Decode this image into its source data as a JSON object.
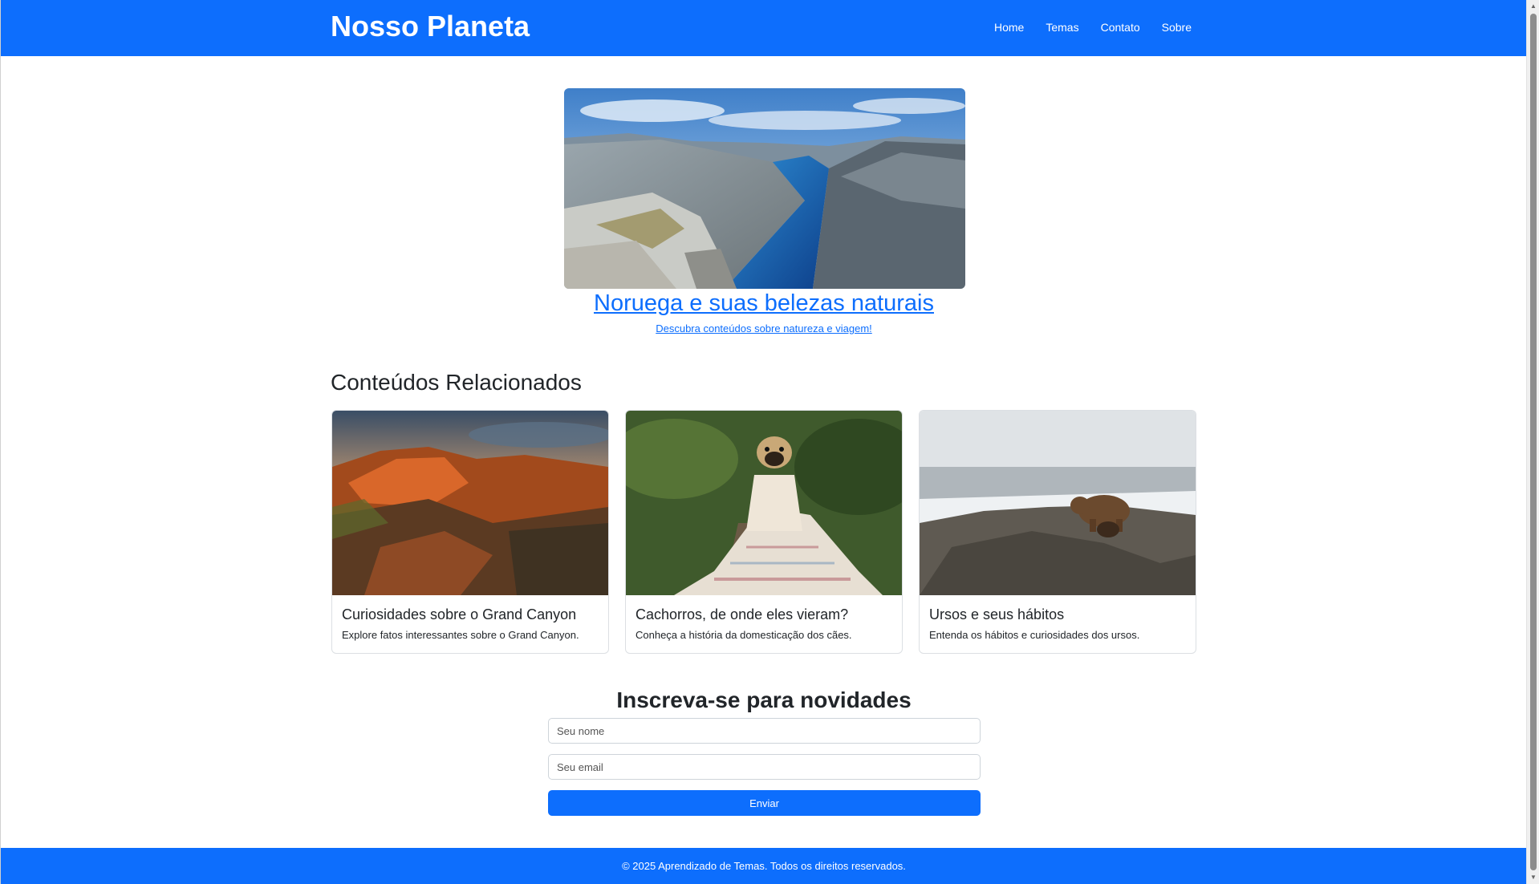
{
  "header": {
    "brand": "Nosso Planeta",
    "nav": [
      "Home",
      "Temas",
      "Contato",
      "Sobre"
    ]
  },
  "hero": {
    "image_icon": "fjord-landscape-image",
    "title": "Noruega e suas belezas naturais",
    "subtitle": "Descubra conteúdos sobre natureza e viagem!"
  },
  "related": {
    "title": "Conteúdos Relacionados",
    "cards": [
      {
        "image": "canyon-image",
        "title": "Curiosidades sobre o Grand Canyon",
        "text": "Explore fatos interessantes sobre o Grand Canyon."
      },
      {
        "image": "pug-blanket-image",
        "title": "Cachorros, de onde eles vieram?",
        "text": "Conheça a história da domesticação dos cães."
      },
      {
        "image": "bear-image",
        "title": "Ursos e seus hábitos",
        "text": "Entenda os hábitos e curiosidades dos ursos."
      }
    ]
  },
  "subscribe": {
    "title": "Inscreva-se para novidades",
    "name_placeholder": "Seu nome",
    "email_placeholder": "Seu email",
    "button": "Enviar"
  },
  "footer": {
    "text": "© 2025 Aprendizado de Temas. Todos os direitos reservados."
  },
  "colors": {
    "primary": "#0d6efd",
    "text": "#212529",
    "border": "#dcdfe3"
  }
}
